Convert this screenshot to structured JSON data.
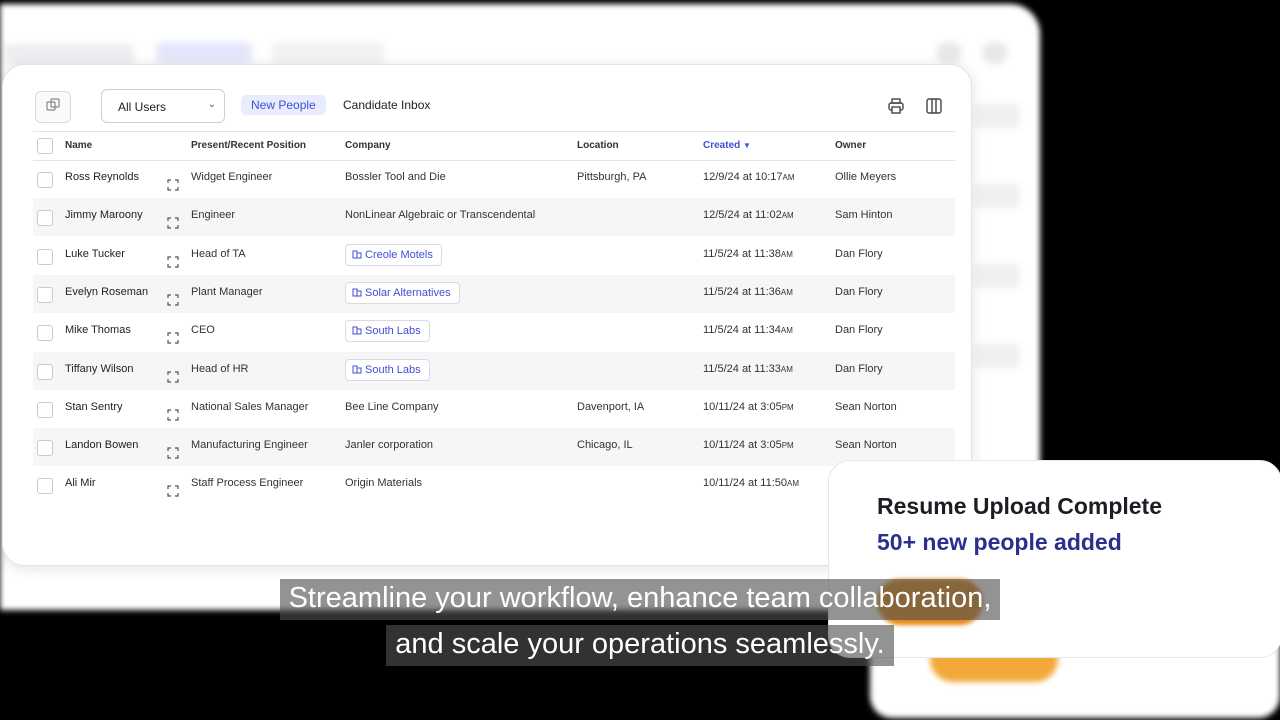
{
  "toolbar": {
    "user_filter": "All Users",
    "tabs": [
      {
        "label": "New People",
        "active": true
      },
      {
        "label": "Candidate Inbox",
        "active": false
      }
    ]
  },
  "table": {
    "columns": [
      "Name",
      "Present/Recent Position",
      "Company",
      "Location",
      "Created",
      "Owner"
    ],
    "sort_column": "Created",
    "rows": [
      {
        "name": "Ross Reynolds",
        "position": "Widget Engineer",
        "company": "Bossler Tool and Die",
        "company_linked": false,
        "location": "Pittsburgh, PA",
        "date": "12/9/24 at 10:17",
        "ampm": "AM",
        "owner": "Ollie Meyers"
      },
      {
        "name": "Jimmy Maroony",
        "position": "Engineer",
        "company": "NonLinear Algebraic or Transcendental",
        "company_linked": false,
        "location": "",
        "date": "12/5/24 at 11:02",
        "ampm": "AM",
        "owner": "Sam Hinton"
      },
      {
        "name": "Luke Tucker",
        "position": "Head of TA",
        "company": "Creole Motels",
        "company_linked": true,
        "location": "",
        "date": "11/5/24 at 11:38",
        "ampm": "AM",
        "owner": "Dan Flory"
      },
      {
        "name": "Evelyn Roseman",
        "position": "Plant Manager",
        "company": "Solar Alternatives",
        "company_linked": true,
        "location": "",
        "date": "11/5/24 at 11:36",
        "ampm": "AM",
        "owner": "Dan Flory"
      },
      {
        "name": "Mike Thomas",
        "position": "CEO",
        "company": "South Labs",
        "company_linked": true,
        "location": "",
        "date": "11/5/24 at 11:34",
        "ampm": "AM",
        "owner": "Dan Flory"
      },
      {
        "name": "Tiffany Wilson",
        "position": "Head of HR",
        "company": "South Labs",
        "company_linked": true,
        "location": "",
        "date": "11/5/24 at 11:33",
        "ampm": "AM",
        "owner": "Dan Flory"
      },
      {
        "name": "Stan Sentry",
        "position": "National Sales Manager",
        "company": "Bee Line Company",
        "company_linked": false,
        "location": "Davenport, IA",
        "date": "10/11/24 at 3:05",
        "ampm": "PM",
        "owner": "Sean Norton"
      },
      {
        "name": "Landon Bowen",
        "position": "Manufacturing Engineer",
        "company": "Janler corporation",
        "company_linked": false,
        "location": "Chicago, IL",
        "date": "10/11/24 at 3:05",
        "ampm": "PM",
        "owner": "Sean Norton"
      },
      {
        "name": "Ali Mir",
        "position": "Staff Process Engineer",
        "company": "Origin Materials",
        "company_linked": false,
        "location": "",
        "date": "10/11/24 at 11:50",
        "ampm": "AM",
        "owner": ""
      }
    ]
  },
  "toast": {
    "title": "Resume Upload Complete",
    "subtitle": "50+ new people added"
  },
  "caption": {
    "line1": "Streamline your workflow, enhance team collaboration,",
    "line2": "and scale your operations seamlessly."
  },
  "colors": {
    "accent": "#3f4fd6",
    "toast_subtitle": "#2b2f8e",
    "toast_button": "#e08a1a"
  },
  "icons": [
    "copy-icon",
    "chevron-down-icon",
    "print-icon",
    "columns-icon",
    "sort-down-icon",
    "expand-icon",
    "building-icon"
  ]
}
